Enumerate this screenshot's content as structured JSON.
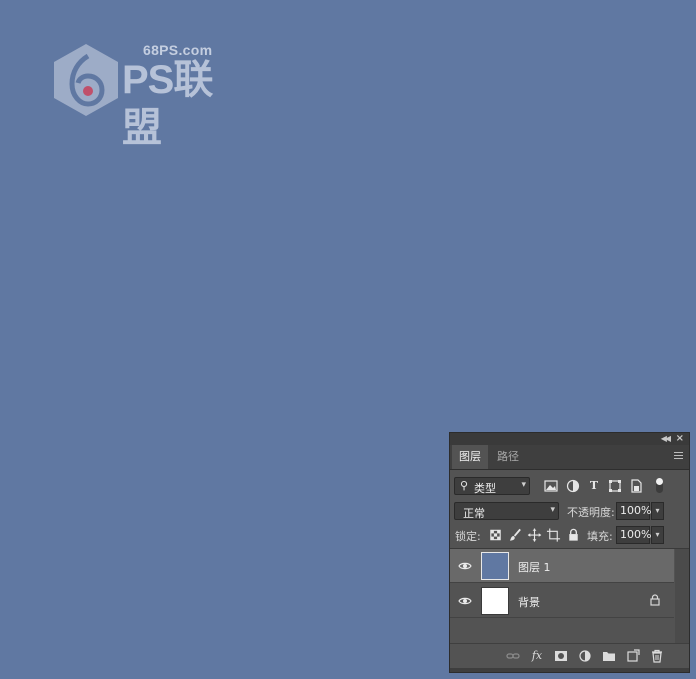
{
  "canvas": {
    "background": "#6078a2"
  },
  "watermark": {
    "site": "68PS.com",
    "brand": "PS联盟"
  },
  "panel": {
    "tabs": [
      {
        "label": "图层",
        "active": true
      },
      {
        "label": "路径",
        "active": false
      }
    ],
    "filter": {
      "selected": "类型",
      "icons": [
        "image-filter-icon",
        "adjustment-filter-icon",
        "type-filter-icon",
        "shape-filter-icon",
        "smart-object-filter-icon",
        "filter-toggle"
      ]
    },
    "blend_mode": "正常",
    "opacity_label": "不透明度:",
    "opacity_value": "100%",
    "lock_label": "锁定:",
    "lock_icons": [
      "lock-transparent-icon",
      "lock-image-icon",
      "lock-position-icon",
      "lock-artboard-icon",
      "lock-all-icon"
    ],
    "fill_label": "填充:",
    "fill_value": "100%",
    "layers": [
      {
        "name": "图层 1",
        "selected": true,
        "visible": true,
        "thumb_color": "#6078a2",
        "locked": false
      },
      {
        "name": "背景",
        "selected": false,
        "visible": true,
        "thumb_color": "#ffffff",
        "locked": true
      }
    ],
    "footer_icons": [
      "link-layers-icon",
      "fx-icon",
      "add-mask-icon",
      "adjustment-layer-icon",
      "new-group-icon",
      "new-layer-icon",
      "delete-layer-icon"
    ]
  }
}
